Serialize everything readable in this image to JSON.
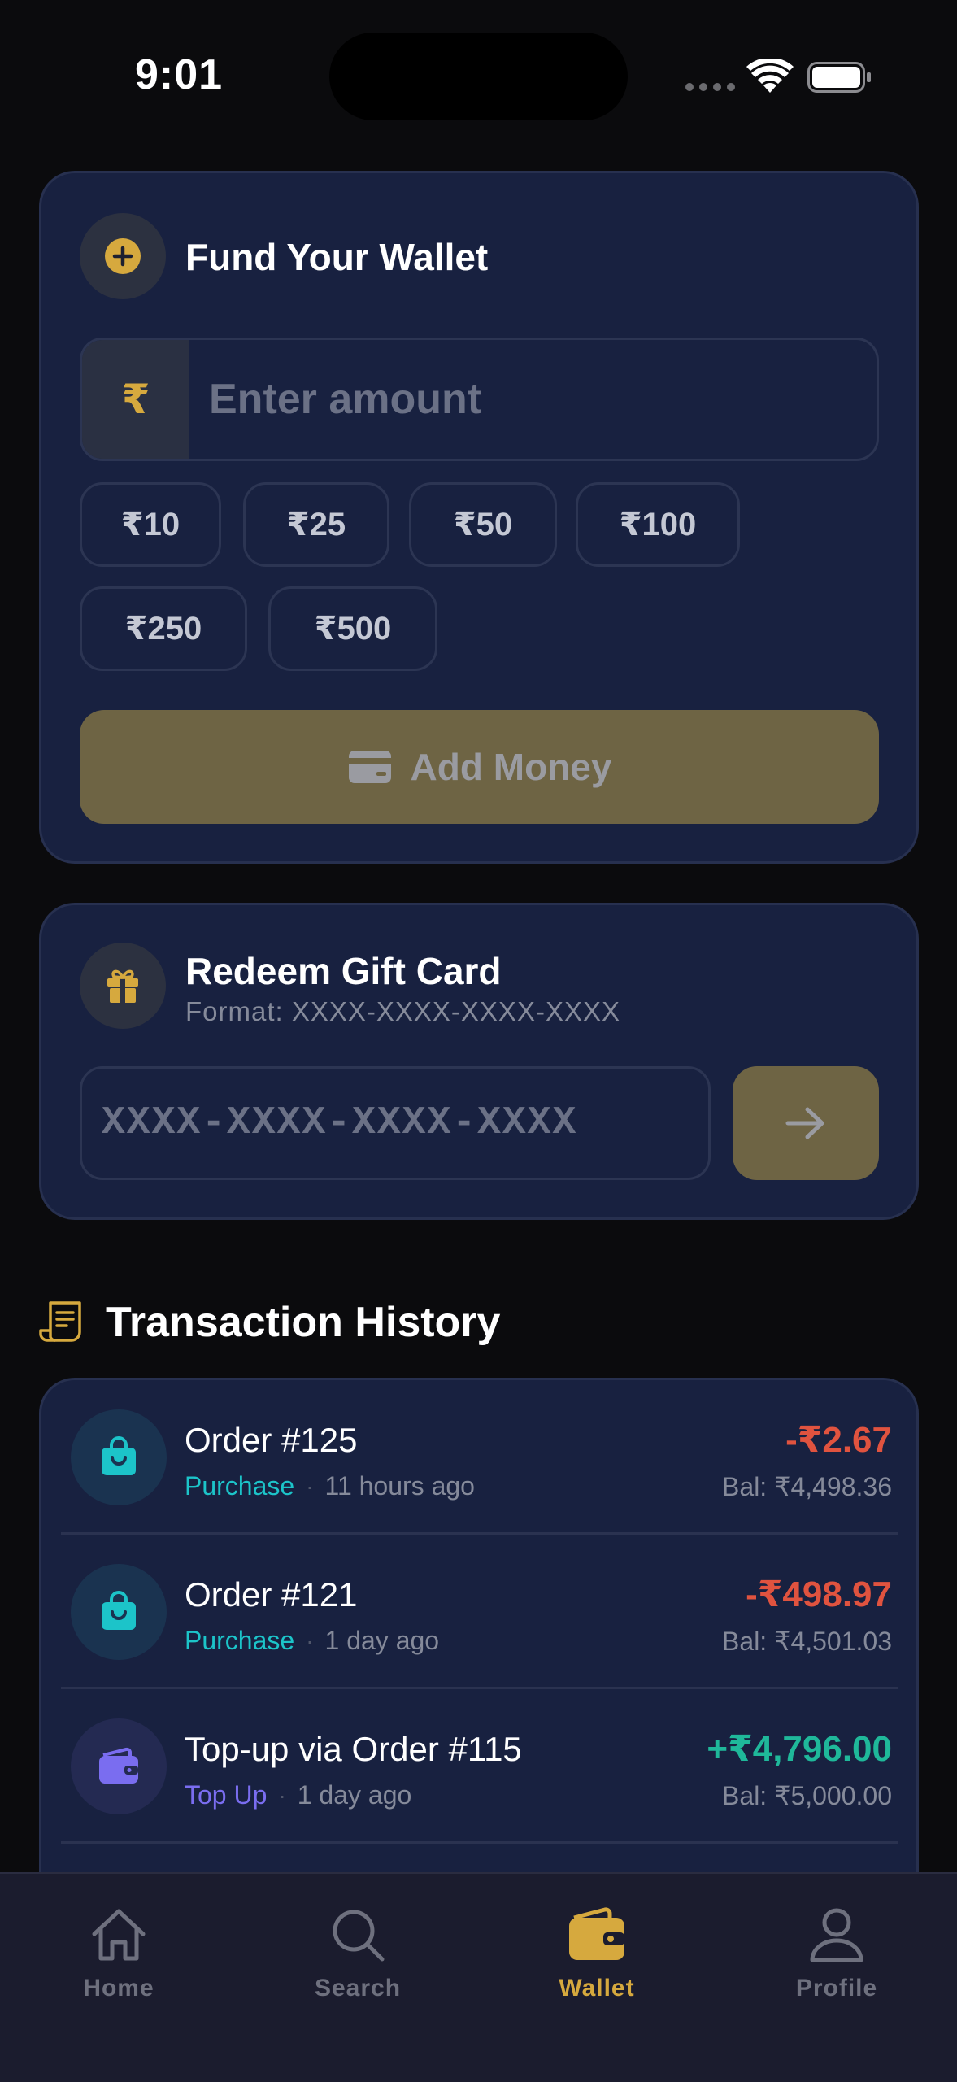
{
  "status_bar": {
    "time": "9:01"
  },
  "fund_wallet": {
    "title": "Fund Your Wallet",
    "currency_symbol": "₹",
    "amount_placeholder": "Enter amount",
    "amount_value": "",
    "quick_amounts": [
      "₹10",
      "₹25",
      "₹50",
      "₹100",
      "₹250",
      "₹500"
    ],
    "add_button_label": "Add Money"
  },
  "redeem": {
    "title": "Redeem Gift Card",
    "format_hint": "Format: XXXX-XXXX-XXXX-XXXX",
    "code_placeholder": "XXXX-XXXX-XXXX-XXXX",
    "code_value": ""
  },
  "history": {
    "title": "Transaction History",
    "items": [
      {
        "name": "Order #125",
        "type": "Purchase",
        "time": "11 hours ago",
        "amount": "-₹2.67",
        "balance": "Bal: ₹4,498.36",
        "kind": "debit"
      },
      {
        "name": "Order #121",
        "type": "Purchase",
        "time": "1 day ago",
        "amount": "-₹498.97",
        "balance": "Bal: ₹4,501.03",
        "kind": "debit"
      },
      {
        "name": "Top-up via Order #115",
        "type": "Top Up",
        "time": "1 day ago",
        "amount": "+₹4,796.00",
        "balance": "Bal: ₹5,000.00",
        "kind": "credit"
      }
    ]
  },
  "tab_bar": {
    "tabs": [
      {
        "label": "Home",
        "icon": "home-icon"
      },
      {
        "label": "Search",
        "icon": "search-icon"
      },
      {
        "label": "Wallet",
        "icon": "wallet-icon",
        "active": true
      },
      {
        "label": "Profile",
        "icon": "profile-icon"
      }
    ]
  },
  "colors": {
    "accent_gold": "#d6a93e",
    "debit_red": "#e0533f",
    "credit_green": "#1fb89a",
    "purchase_teal": "#1cc4c9",
    "topup_purple": "#7a6df0",
    "card_bg": "#182140"
  }
}
